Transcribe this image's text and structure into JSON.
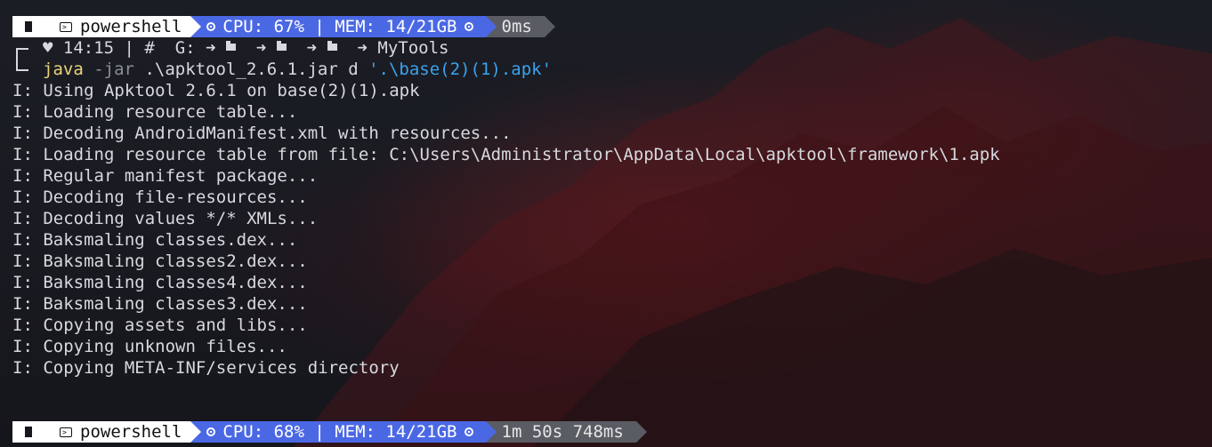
{
  "window": {
    "shell_name": "powershell"
  },
  "prompt_top": {
    "shell": "powershell",
    "system": "CPU: 67% | MEM: 14/21GB",
    "duration": "0ms"
  },
  "path_line": {
    "time": "♥ 14:15 | #",
    "drive": "G:",
    "separator": "➜",
    "folder": "MyTools"
  },
  "command": {
    "program": "java",
    "flag": "-jar",
    "args": ".\\apktool_2.6.1.jar d",
    "target": "'.\\base(2)(1).apk'"
  },
  "output": [
    "I: Using Apktool 2.6.1 on base(2)(1).apk",
    "I: Loading resource table...",
    "I: Decoding AndroidManifest.xml with resources...",
    "I: Loading resource table from file: C:\\Users\\Administrator\\AppData\\Local\\apktool\\framework\\1.apk",
    "I: Regular manifest package...",
    "I: Decoding file-resources...",
    "I: Decoding values */* XMLs...",
    "I: Baksmaling classes.dex...",
    "I: Baksmaling classes2.dex...",
    "I: Baksmaling classes4.dex...",
    "I: Baksmaling classes3.dex...",
    "I: Copying assets and libs...",
    "I: Copying unknown files...",
    "I: Copying META-INF/services directory"
  ],
  "prompt_bottom": {
    "shell": "powershell",
    "system": "CPU: 68% | MEM: 14/21GB",
    "duration": "1m 50s 748ms"
  },
  "colors": {
    "os_segment": "#ffffff",
    "system_segment": "#4b68e4",
    "duration_segment": "#5a5c63",
    "command_program": "#e9d37a",
    "command_string": "#3aa2ee"
  },
  "icons": {
    "os": "windows-icon",
    "shell": "terminal-icon",
    "system": "chip-icon",
    "folder": "folder-icon",
    "heart": "heart-icon"
  }
}
